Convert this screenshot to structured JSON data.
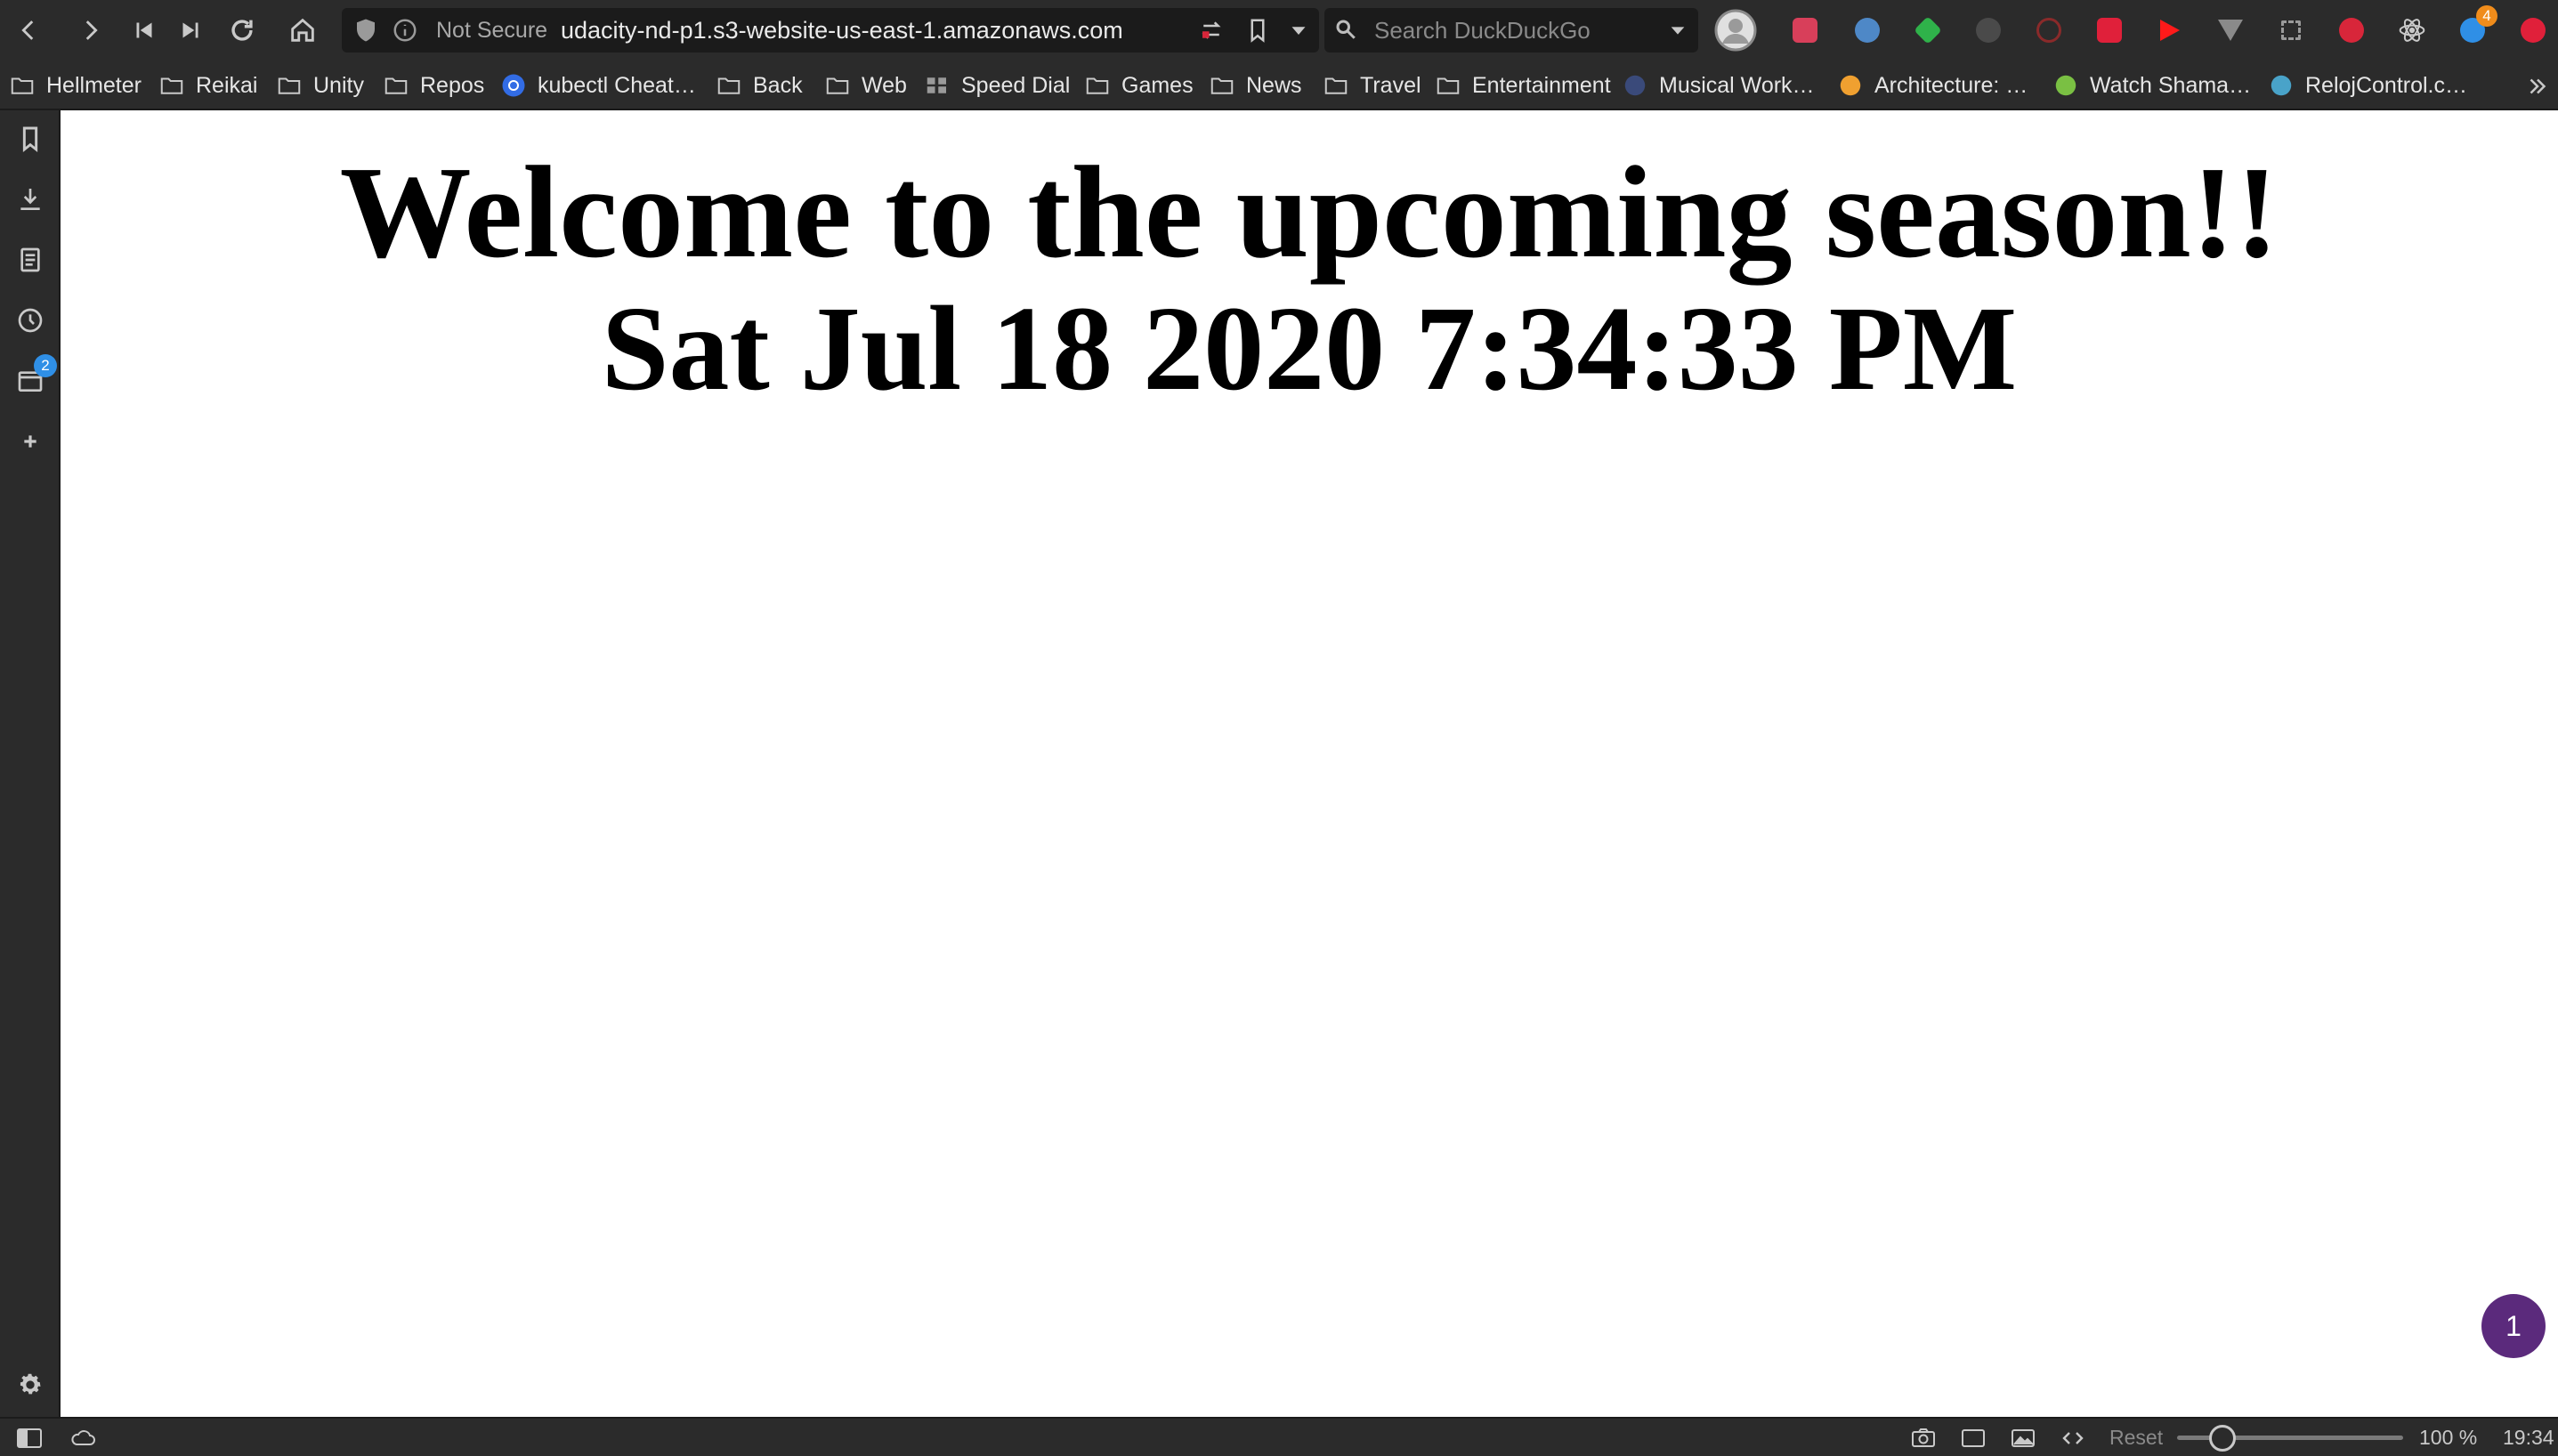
{
  "toolbar": {
    "back_icon": "chevron-left-icon",
    "forward_icon": "chevron-right-icon",
    "rewind_icon": "skip-back-icon",
    "fastforward_icon": "skip-forward-icon",
    "reload_icon": "reload-icon",
    "home_icon": "home-icon",
    "security_text": "Not Secure",
    "url": "udacity-nd-p1.s3-website-us-east-1.amazonaws.com",
    "search_placeholder": "Search DuckDuckGo",
    "extensions_badge": "4"
  },
  "bookmarks": [
    {
      "label": "Hellmeter",
      "icon": "folder-icon"
    },
    {
      "label": "Reikai",
      "icon": "folder-icon"
    },
    {
      "label": "Unity",
      "icon": "folder-icon"
    },
    {
      "label": "Repos",
      "icon": "folder-icon"
    },
    {
      "label": "kubectl Cheat…",
      "icon": "kubernetes-icon"
    },
    {
      "label": "Back",
      "icon": "folder-icon"
    },
    {
      "label": "Web",
      "icon": "folder-icon"
    },
    {
      "label": "Speed Dial",
      "icon": "speed-dial-icon"
    },
    {
      "label": "Games",
      "icon": "folder-icon"
    },
    {
      "label": "News",
      "icon": "folder-icon"
    },
    {
      "label": "Travel",
      "icon": "folder-icon"
    },
    {
      "label": "Entertainment",
      "icon": "folder-icon"
    },
    {
      "label": "Musical Work…",
      "icon": "site-icon"
    },
    {
      "label": "Architecture: …",
      "icon": "site-icon"
    },
    {
      "label": "Watch Shama…",
      "icon": "site-icon"
    },
    {
      "label": "RelojControl.c…",
      "icon": "site-icon"
    }
  ],
  "sidepanel": {
    "window_badge": "2"
  },
  "page": {
    "heading": "Welcome to the upcoming season!!",
    "datetime": "Sat Jul 18 2020 7:34:33 PM",
    "fab_count": "1"
  },
  "statusbar": {
    "reset_label": "Reset",
    "zoom_level": "100 %",
    "clock": "19:34",
    "zoom_fraction": 0.2
  },
  "colors": {
    "chrome": "#2b2b2b",
    "fab": "#5b2a7c",
    "badge_blue": "#2f8fe6",
    "badge_orange": "#f08c1b"
  }
}
